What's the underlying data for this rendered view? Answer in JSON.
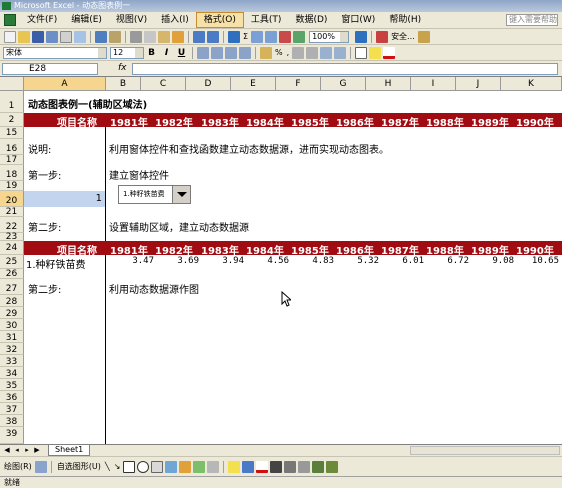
{
  "window": {
    "title": "Microsoft Excel - 动态图表例一"
  },
  "menu": {
    "items": [
      "文件(F)",
      "编辑(E)",
      "视图(V)",
      "插入(I)",
      "格式(O)",
      "工具(T)",
      "数据(D)",
      "窗口(W)",
      "帮助(H)"
    ],
    "active_index": 4,
    "help_placeholder": "键入需要帮助"
  },
  "toolbar": {
    "zoom": "100%",
    "security_label": "安全..."
  },
  "format_bar": {
    "font_name": "宋体",
    "font_size": "12",
    "bold": "B",
    "italic": "I",
    "underline": "U"
  },
  "formula_bar": {
    "name_box": "E28",
    "fx": "fx",
    "formula": ""
  },
  "columns": [
    "A",
    "B",
    "C",
    "D",
    "E",
    "F",
    "G",
    "H",
    "I",
    "J",
    "K"
  ],
  "selected_column": "A",
  "rows": [
    "1",
    "2",
    "15",
    "16",
    "17",
    "18",
    "19",
    "20",
    "21",
    "22",
    "23",
    "24",
    "25",
    "26",
    "27",
    "28",
    "29",
    "30",
    "31",
    "32",
    "33",
    "34",
    "35",
    "36",
    "37",
    "38",
    "39"
  ],
  "selected_row": "20",
  "sheet": {
    "title": "动态图表例一(辅助区域法)",
    "header": {
      "label": "项目名称",
      "years": [
        "1981年",
        "1982年",
        "1983年",
        "1984年",
        "1985年",
        "1986年",
        "1987年",
        "1988年",
        "1989年",
        "1990年"
      ]
    },
    "row16": {
      "a": "说明:",
      "b": "利用窗体控件和查找函数建立动态数据源，进而实现动态图表。"
    },
    "row18": {
      "a": "第一步:",
      "b": "建立窗体控件"
    },
    "row20": {
      "a": "1"
    },
    "combo_value": "1.种籽铁苗费",
    "row22": {
      "a": "第二步:",
      "b": "设置辅助区域，建立动态数据源"
    },
    "row25": {
      "a": "1.种籽铁苗费",
      "values": [
        "3.47",
        "3.69",
        "3.94",
        "4.56",
        "4.83",
        "5.32",
        "6.01",
        "6.72",
        "9.08",
        "10.65"
      ]
    },
    "row27": {
      "a": "第二步:",
      "b": "利用动态数据源作图"
    }
  },
  "tabs": {
    "sheet1": "Sheet1"
  },
  "drawbar": {
    "draw_label": "绘图(R)",
    "autoshape_label": "自选图形(U)"
  },
  "status": {
    "text": "就绪"
  },
  "colors": {
    "band": "#a00c12",
    "selection": "#c2d4ee",
    "header_highlight": "#f6d58e"
  }
}
